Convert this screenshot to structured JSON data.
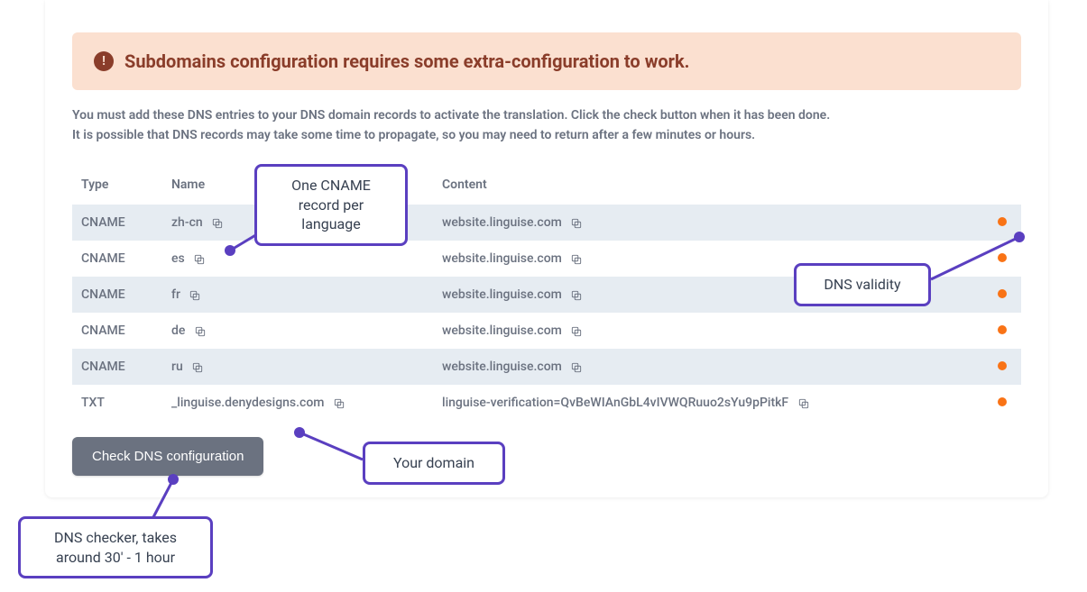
{
  "alert": {
    "text": "Subdomains configuration requires some extra-configuration to work."
  },
  "description": {
    "line1": "You must add these DNS entries to your DNS domain records to activate the translation. Click the check button when it has been done.",
    "line2": "It is possible that DNS records may take some time to propagate, so you may need to return after a few minutes or hours."
  },
  "table": {
    "headers": {
      "type": "Type",
      "name": "Name",
      "content": "Content"
    },
    "rows": [
      {
        "type": "CNAME",
        "name": "zh-cn",
        "content": "website.linguise.com",
        "status": "invalid"
      },
      {
        "type": "CNAME",
        "name": "es",
        "content": "website.linguise.com",
        "status": "invalid"
      },
      {
        "type": "CNAME",
        "name": "fr",
        "content": "website.linguise.com",
        "status": "invalid"
      },
      {
        "type": "CNAME",
        "name": "de",
        "content": "website.linguise.com",
        "status": "invalid"
      },
      {
        "type": "CNAME",
        "name": "ru",
        "content": "website.linguise.com",
        "status": "invalid"
      },
      {
        "type": "TXT",
        "name": "_linguise.denydesigns.com",
        "content": "linguise-verification=QvBeWIAnGbL4vIVWQRuuo2sYu9pPitkF",
        "status": "invalid"
      }
    ]
  },
  "button": {
    "check_label": "Check DNS configuration"
  },
  "annotations": {
    "cname_per_lang": "One CNAME record per language",
    "dns_validity": "DNS validity",
    "your_domain": "Your domain",
    "dns_checker": "DNS checker, takes around 30' - 1 hour"
  }
}
